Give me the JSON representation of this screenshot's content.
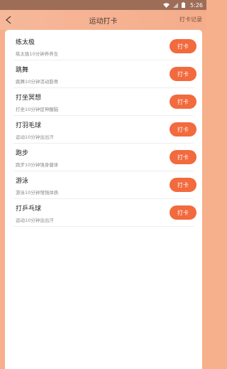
{
  "status_bar": {
    "time": "5:26"
  },
  "header": {
    "title": "运动打卡",
    "record_label": "打卡记录"
  },
  "checkin_label": "打卡",
  "items": [
    {
      "title": "练太极",
      "desc": "练太极10分钟养养生"
    },
    {
      "title": "跳舞",
      "desc": "跳舞10分钟活动筋骨"
    },
    {
      "title": "打坐冥想",
      "desc": "打坐10分钟促神醒脑"
    },
    {
      "title": "打羽毛球",
      "desc": "运动10分钟出出汗"
    },
    {
      "title": "跑步",
      "desc": "跑步10分钟强身健体"
    },
    {
      "title": "游泳",
      "desc": "游泳10分钟增强体质"
    },
    {
      "title": "打乒乓球",
      "desc": "运动10分钟出出汗"
    }
  ],
  "colors": {
    "accent": "#f26a3d",
    "header_bg": "#f6b89a",
    "status_bar_bg": "#9e6d58"
  }
}
